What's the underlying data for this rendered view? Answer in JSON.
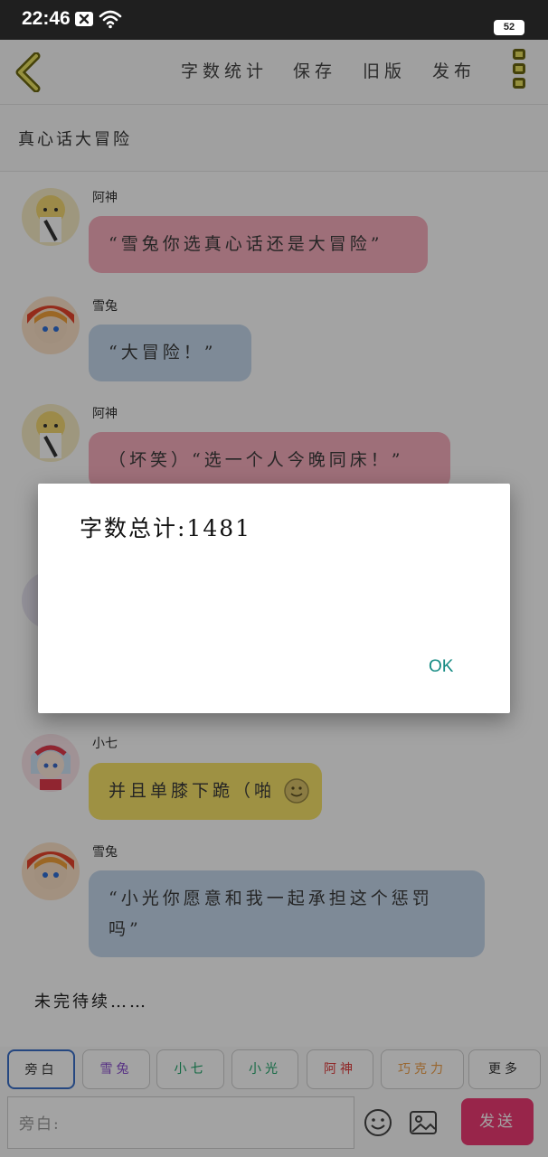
{
  "status_bar": {
    "time": "22:46",
    "battery": "52"
  },
  "toolbar": {
    "word_count": "字数统计",
    "save": "保存",
    "old_version": "旧版",
    "publish": "发布"
  },
  "story": {
    "title": "真心话大冒险"
  },
  "messages": [
    {
      "name": "阿神",
      "text": "“雪兔你选真心话还是大冒险”",
      "color": "#f8aebd"
    },
    {
      "name": "雪兔",
      "text": "“大冒险！”",
      "color": "#c5d8ec"
    },
    {
      "name": "阿神",
      "text": "（坏笑）“选一个人今晚同床！”",
      "color": "#f8aebd"
    },
    {
      "name": "小七",
      "text": "并且单膝下跪（啪",
      "color": "#f7e36a"
    },
    {
      "name": "雪兔",
      "text": "“小光你愿意和我一起承担这个惩罚吗”",
      "color": "#c5d8ec"
    }
  ],
  "ending_text": "未完待续……",
  "dialog": {
    "message": "字数总计:1481",
    "ok_label": "OK"
  },
  "roles": [
    {
      "label": "旁白",
      "color": "#333333"
    },
    {
      "label": "雪兔",
      "color": "#8a4fcf"
    },
    {
      "label": "小七",
      "color": "#1ea56a"
    },
    {
      "label": "小光",
      "color": "#1ea56a"
    },
    {
      "label": "阿神",
      "color": "#e03a3a"
    },
    {
      "label": "巧克力",
      "color": "#f0a04a"
    },
    {
      "label": "更多",
      "color": "#333333"
    }
  ],
  "input": {
    "placeholder": "旁白:"
  },
  "send_label": "发送"
}
